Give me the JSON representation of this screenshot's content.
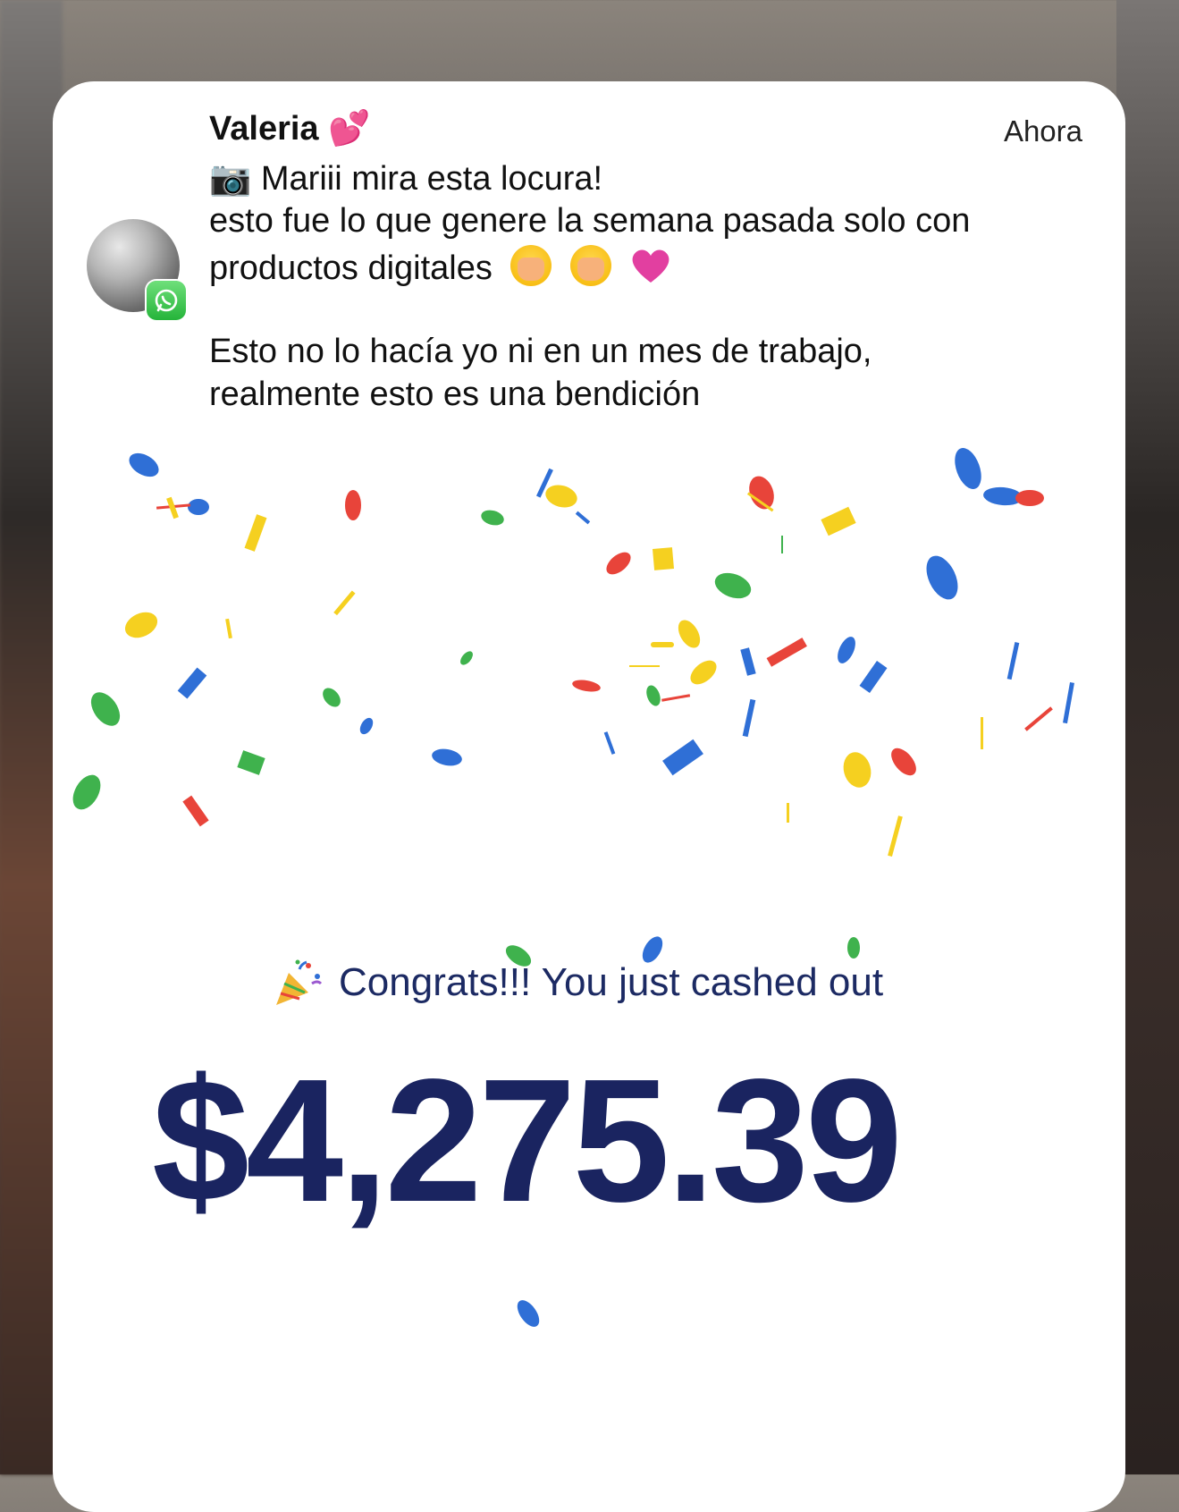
{
  "notification": {
    "sender": "Valeria 💕",
    "time": "Ahora",
    "app_icon": "whatsapp-icon",
    "avatar": "contact-avatar",
    "lines": [
      "📷 Mariii mira esta locura!",
      "esto fue lo que genere la semana pasada solo con",
      "productos digitales",
      "Esto no lo hacía yo ni en un mes de trabajo,",
      "realmente esto es una bendición"
    ]
  },
  "image": {
    "congrats_text": "Congrats!!! You just cashed out",
    "amount": "$4,275.39",
    "confetti_colors": [
      "#2f6fd6",
      "#e8443a",
      "#f5d020",
      "#3fb24d"
    ]
  }
}
